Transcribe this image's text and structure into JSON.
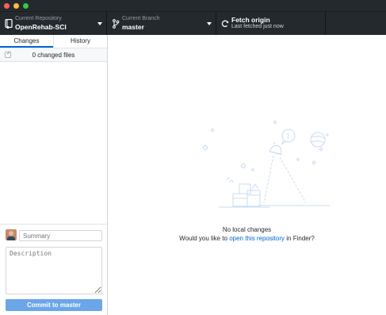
{
  "toolbar": {
    "repository": {
      "small": "Current Repository",
      "name": "OpenRehab-SCI",
      "icon": "repo-icon"
    },
    "branch": {
      "small": "Current Branch",
      "name": "master",
      "icon": "branch-icon"
    },
    "fetch": {
      "title": "Fetch origin",
      "subtitle": "Last fetched just now",
      "icon": "sync-icon"
    }
  },
  "sidebar": {
    "tabs": [
      {
        "label": "Changes",
        "active": true
      },
      {
        "label": "History",
        "active": false
      }
    ],
    "files_count": "0 changed files",
    "commit": {
      "summary_placeholder": "Summary",
      "description_placeholder": "Description",
      "button_label": "Commit to master"
    }
  },
  "main": {
    "empty_title": "No local changes",
    "empty_prefix": "Would you like to",
    "empty_link": "open this repository",
    "empty_suffix": "in Finder?"
  },
  "colors": {
    "toolbar_bg": "#24292e",
    "accent": "#0366d6",
    "commit_button": "#6aa6e8",
    "illustration": "#c9dcf2"
  }
}
